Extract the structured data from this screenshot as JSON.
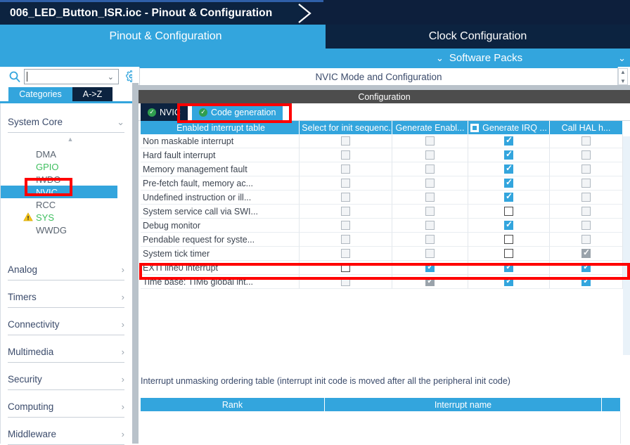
{
  "titlebar": {
    "file_title": "006_LED_Button_ISR.ioc - Pinout & Configuration",
    "arrow_icon": "chevron-right-breadcrumb"
  },
  "tabs": [
    {
      "label": "Pinout & Configuration",
      "selected": true
    },
    {
      "label": "Clock Configuration",
      "selected": false
    }
  ],
  "packs_bar": {
    "label": "Software Packs",
    "chevron": "⌄",
    "right_chevron": "⌄"
  },
  "sidebar": {
    "search": {
      "value": "",
      "placeholder": "",
      "icon": "search-icon",
      "dropdown_icon": "chevron-down-icon"
    },
    "gear_icon": "gear-icon",
    "category_tabs": [
      {
        "label": "Categories",
        "selected": true
      },
      {
        "label": "A->Z",
        "selected": false
      }
    ],
    "groups": [
      {
        "label": "System Core",
        "expanded": true,
        "arrow": "⌄",
        "items": [
          {
            "label": "DMA",
            "state": "plain"
          },
          {
            "label": "GPIO",
            "state": "configured"
          },
          {
            "label": "IWDG",
            "state": "plain"
          },
          {
            "label": "NVIC",
            "state": "selected"
          },
          {
            "label": "RCC",
            "state": "plain"
          },
          {
            "label": "SYS",
            "state": "configured",
            "warning": true
          },
          {
            "label": "WWDG",
            "state": "plain"
          }
        ]
      },
      {
        "label": "Analog",
        "expanded": false,
        "arrow": "›",
        "items": []
      },
      {
        "label": "Timers",
        "expanded": false,
        "arrow": "›",
        "items": []
      },
      {
        "label": "Connectivity",
        "expanded": false,
        "arrow": "›",
        "items": []
      },
      {
        "label": "Multimedia",
        "expanded": false,
        "arrow": "›",
        "items": []
      },
      {
        "label": "Security",
        "expanded": false,
        "arrow": "›",
        "items": []
      },
      {
        "label": "Computing",
        "expanded": false,
        "arrow": "›",
        "items": []
      },
      {
        "label": "Middleware",
        "expanded": false,
        "arrow": "›",
        "items": []
      }
    ]
  },
  "main": {
    "mode_title": "NVIC Mode and Configuration",
    "config_bar": "Configuration",
    "subtabs": [
      {
        "label": "NVIC",
        "selected": false,
        "badge": "✓"
      },
      {
        "label": "Code generation",
        "selected": true,
        "badge": "✓"
      }
    ],
    "table": {
      "columns": [
        {
          "label": "Enabled interrupt table",
          "header_checkbox": "none"
        },
        {
          "label": "Select for init sequenc...",
          "header_checkbox": "empty"
        },
        {
          "label": "Generate Enabl...",
          "header_checkbox": "none"
        },
        {
          "label": "Generate IRQ ...",
          "header_checkbox": "partial"
        },
        {
          "label": "Call HAL h...",
          "header_checkbox": "none"
        }
      ],
      "rows": [
        {
          "name": "Non maskable interrupt",
          "select_init": "off",
          "gen_enable": "off",
          "gen_irq": "on",
          "call_hal": "off"
        },
        {
          "name": "Hard fault interrupt",
          "select_init": "off",
          "gen_enable": "off",
          "gen_irq": "on",
          "call_hal": "off"
        },
        {
          "name": "Memory management fault",
          "select_init": "off",
          "gen_enable": "off",
          "gen_irq": "on",
          "call_hal": "off"
        },
        {
          "name": "Pre-fetch fault, memory ac...",
          "select_init": "off",
          "gen_enable": "off",
          "gen_irq": "on",
          "call_hal": "off"
        },
        {
          "name": "Undefined instruction or ill...",
          "select_init": "off",
          "gen_enable": "off",
          "gen_irq": "on",
          "call_hal": "off"
        },
        {
          "name": "System service call via SWI...",
          "select_init": "off",
          "gen_enable": "off",
          "gen_irq": "offw",
          "call_hal": "off"
        },
        {
          "name": "Debug monitor",
          "select_init": "off",
          "gen_enable": "off",
          "gen_irq": "on",
          "call_hal": "off"
        },
        {
          "name": "Pendable request for syste...",
          "select_init": "off",
          "gen_enable": "off",
          "gen_irq": "offw",
          "call_hal": "off"
        },
        {
          "name": "System tick timer",
          "select_init": "off",
          "gen_enable": "off",
          "gen_irq": "offw",
          "call_hal": "ondis"
        },
        {
          "name": "EXTI line0 interrupt",
          "select_init": "offw",
          "gen_enable": "on",
          "gen_irq": "on",
          "call_hal": "on",
          "highlighted": true
        },
        {
          "name": "Time base: TIM6 global int...",
          "select_init": "off",
          "gen_enable": "ondis",
          "gen_irq": "on",
          "call_hal": "on"
        }
      ]
    },
    "ordering": {
      "note": "Interrupt unmasking ordering table (interrupt init code is moved after all the peripheral init code)",
      "columns": [
        "Rank",
        "Interrupt name",
        ""
      ],
      "rows": []
    }
  },
  "annotations": {
    "colors": {
      "highlight_red": "#ff0000",
      "accent_blue": "#33a5dd",
      "dark_navy": "#0c2340"
    },
    "boxes": [
      {
        "name": "nvic-sidebar-highlight"
      },
      {
        "name": "code-generation-tab-highlight"
      },
      {
        "name": "exti-line0-row-highlight"
      }
    ]
  }
}
